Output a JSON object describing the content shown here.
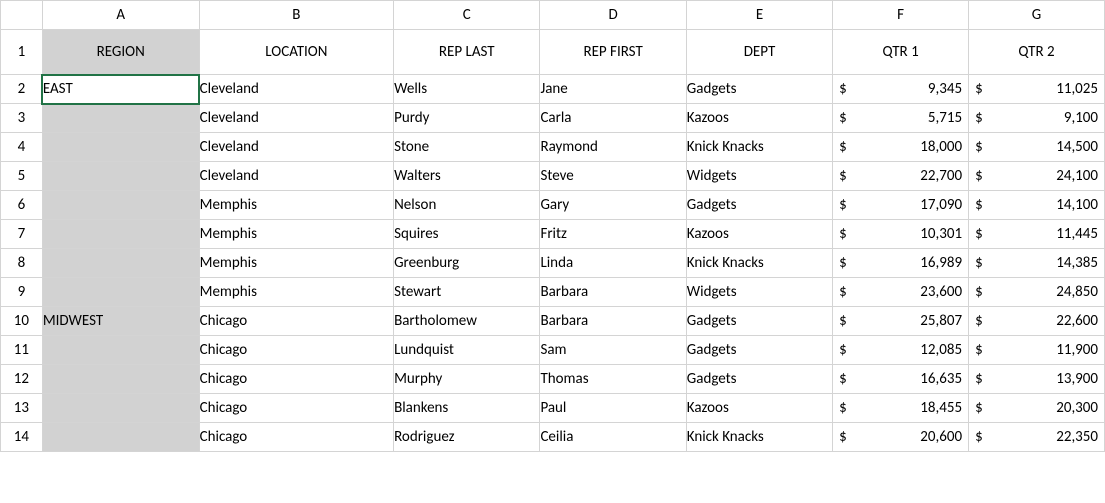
{
  "chart_data": {
    "type": "table",
    "columns": [
      "REGION",
      "LOCATION",
      "REP LAST",
      "REP FIRST",
      "DEPT",
      "QTR 1",
      "QTR 2"
    ],
    "rows": [
      [
        "EAST",
        "Cleveland",
        "Wells",
        "Jane",
        "Gadgets",
        9345,
        11025
      ],
      [
        "",
        "Cleveland",
        "Purdy",
        "Carla",
        "Kazoos",
        5715,
        9100
      ],
      [
        "",
        "Cleveland",
        "Stone",
        "Raymond",
        "Knick Knacks",
        18000,
        14500
      ],
      [
        "",
        "Cleveland",
        "Walters",
        "Steve",
        "Widgets",
        22700,
        24100
      ],
      [
        "",
        "Memphis",
        "Nelson",
        "Gary",
        "Gadgets",
        17090,
        14100
      ],
      [
        "",
        "Memphis",
        "Squires",
        "Fritz",
        "Kazoos",
        10301,
        11445
      ],
      [
        "",
        "Memphis",
        "Greenburg",
        "Linda",
        "Knick Knacks",
        16989,
        14385
      ],
      [
        "",
        "Memphis",
        "Stewart",
        "Barbara",
        "Widgets",
        23600,
        24850
      ],
      [
        "MIDWEST",
        "Chicago",
        "Bartholomew",
        "Barbara",
        "Gadgets",
        25807,
        22600
      ],
      [
        "",
        "Chicago",
        "Lundquist",
        "Sam",
        "Gadgets",
        12085,
        11900
      ],
      [
        "",
        "Chicago",
        "Murphy",
        "Thomas",
        "Gadgets",
        16635,
        13900
      ],
      [
        "",
        "Chicago",
        "Blankens",
        "Paul",
        "Kazoos",
        18455,
        20300
      ],
      [
        "",
        "Chicago",
        "Rodriguez",
        "Ceilia",
        "Knick Knacks",
        20600,
        22350
      ]
    ]
  },
  "column_letters": [
    "A",
    "B",
    "C",
    "D",
    "E",
    "F",
    "G"
  ],
  "row_numbers": [
    "1",
    "2",
    "3",
    "4",
    "5",
    "6",
    "7",
    "8",
    "9",
    "10",
    "11",
    "12",
    "13",
    "14"
  ],
  "headers": {
    "A": "REGION",
    "B": "LOCATION",
    "C": "REP LAST",
    "D": "REP FIRST",
    "E": "DEPT",
    "F": "QTR 1",
    "G": "QTR 2"
  },
  "rows": [
    {
      "A": "EAST",
      "B": "Cleveland",
      "C": "Wells",
      "D": "Jane",
      "E": "Gadgets",
      "F": "9,345",
      "G": "11,025"
    },
    {
      "A": "",
      "B": "Cleveland",
      "C": "Purdy",
      "D": "Carla",
      "E": "Kazoos",
      "F": "5,715",
      "G": "9,100"
    },
    {
      "A": "",
      "B": "Cleveland",
      "C": "Stone",
      "D": "Raymond",
      "E": "Knick Knacks",
      "F": "18,000",
      "G": "14,500"
    },
    {
      "A": "",
      "B": "Cleveland",
      "C": "Walters",
      "D": "Steve",
      "E": "Widgets",
      "F": "22,700",
      "G": "24,100"
    },
    {
      "A": "",
      "B": "Memphis",
      "C": "Nelson",
      "D": "Gary",
      "E": "Gadgets",
      "F": "17,090",
      "G": "14,100"
    },
    {
      "A": "",
      "B": "Memphis",
      "C": "Squires",
      "D": "Fritz",
      "E": "Kazoos",
      "F": "10,301",
      "G": "11,445"
    },
    {
      "A": "",
      "B": "Memphis",
      "C": "Greenburg",
      "D": "Linda",
      "E": "Knick Knacks",
      "F": "16,989",
      "G": "14,385"
    },
    {
      "A": "",
      "B": "Memphis",
      "C": "Stewart",
      "D": "Barbara",
      "E": "Widgets",
      "F": "23,600",
      "G": "24,850"
    },
    {
      "A": "MIDWEST",
      "B": "Chicago",
      "C": "Bartholomew",
      "D": "Barbara",
      "E": "Gadgets",
      "F": "25,807",
      "G": "22,600"
    },
    {
      "A": "",
      "B": "Chicago",
      "C": "Lundquist",
      "D": "Sam",
      "E": "Gadgets",
      "F": "12,085",
      "G": "11,900"
    },
    {
      "A": "",
      "B": "Chicago",
      "C": "Murphy",
      "D": "Thomas",
      "E": "Gadgets",
      "F": "16,635",
      "G": "13,900"
    },
    {
      "A": "",
      "B": "Chicago",
      "C": "Blankens",
      "D": "Paul",
      "E": "Kazoos",
      "F": "18,455",
      "G": "20,300"
    },
    {
      "A": "",
      "B": "Chicago",
      "C": "Rodriguez",
      "D": "Ceilia",
      "E": "Knick Knacks",
      "F": "20,600",
      "G": "22,350"
    }
  ],
  "currency_symbol": "$",
  "active_cell": "A2",
  "selected_column": "A"
}
